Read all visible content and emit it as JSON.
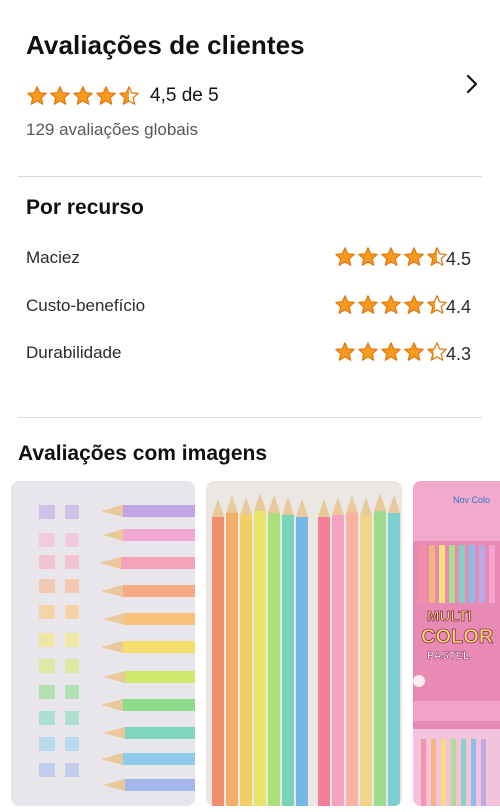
{
  "summary": {
    "title": "Avaliações de clientes",
    "rating_text": "4,5 de 5",
    "global_count": "129 avaliações globais",
    "rating_value": 4.5
  },
  "features": {
    "title": "Por recurso",
    "items": [
      {
        "label": "Maciez",
        "value": "4.5",
        "rating": 4.5
      },
      {
        "label": "Custo-benefício",
        "value": "4.4",
        "rating": 4.4
      },
      {
        "label": "Durabilidade",
        "value": "4.3",
        "rating": 4.3
      }
    ]
  },
  "images": {
    "title": "Avaliações com imagens",
    "box_text": {
      "line1": "MULTI",
      "line2": "COLOR",
      "line3": "PASTEL",
      "corner": "Nov Colo"
    }
  },
  "colors": {
    "star": "#f79b1f",
    "star_outline": "#e47911",
    "divider": "#d5d9d9",
    "text_secondary": "#565959"
  },
  "icons": {
    "star": "star-icon",
    "chevron": "chevron-right-icon"
  }
}
